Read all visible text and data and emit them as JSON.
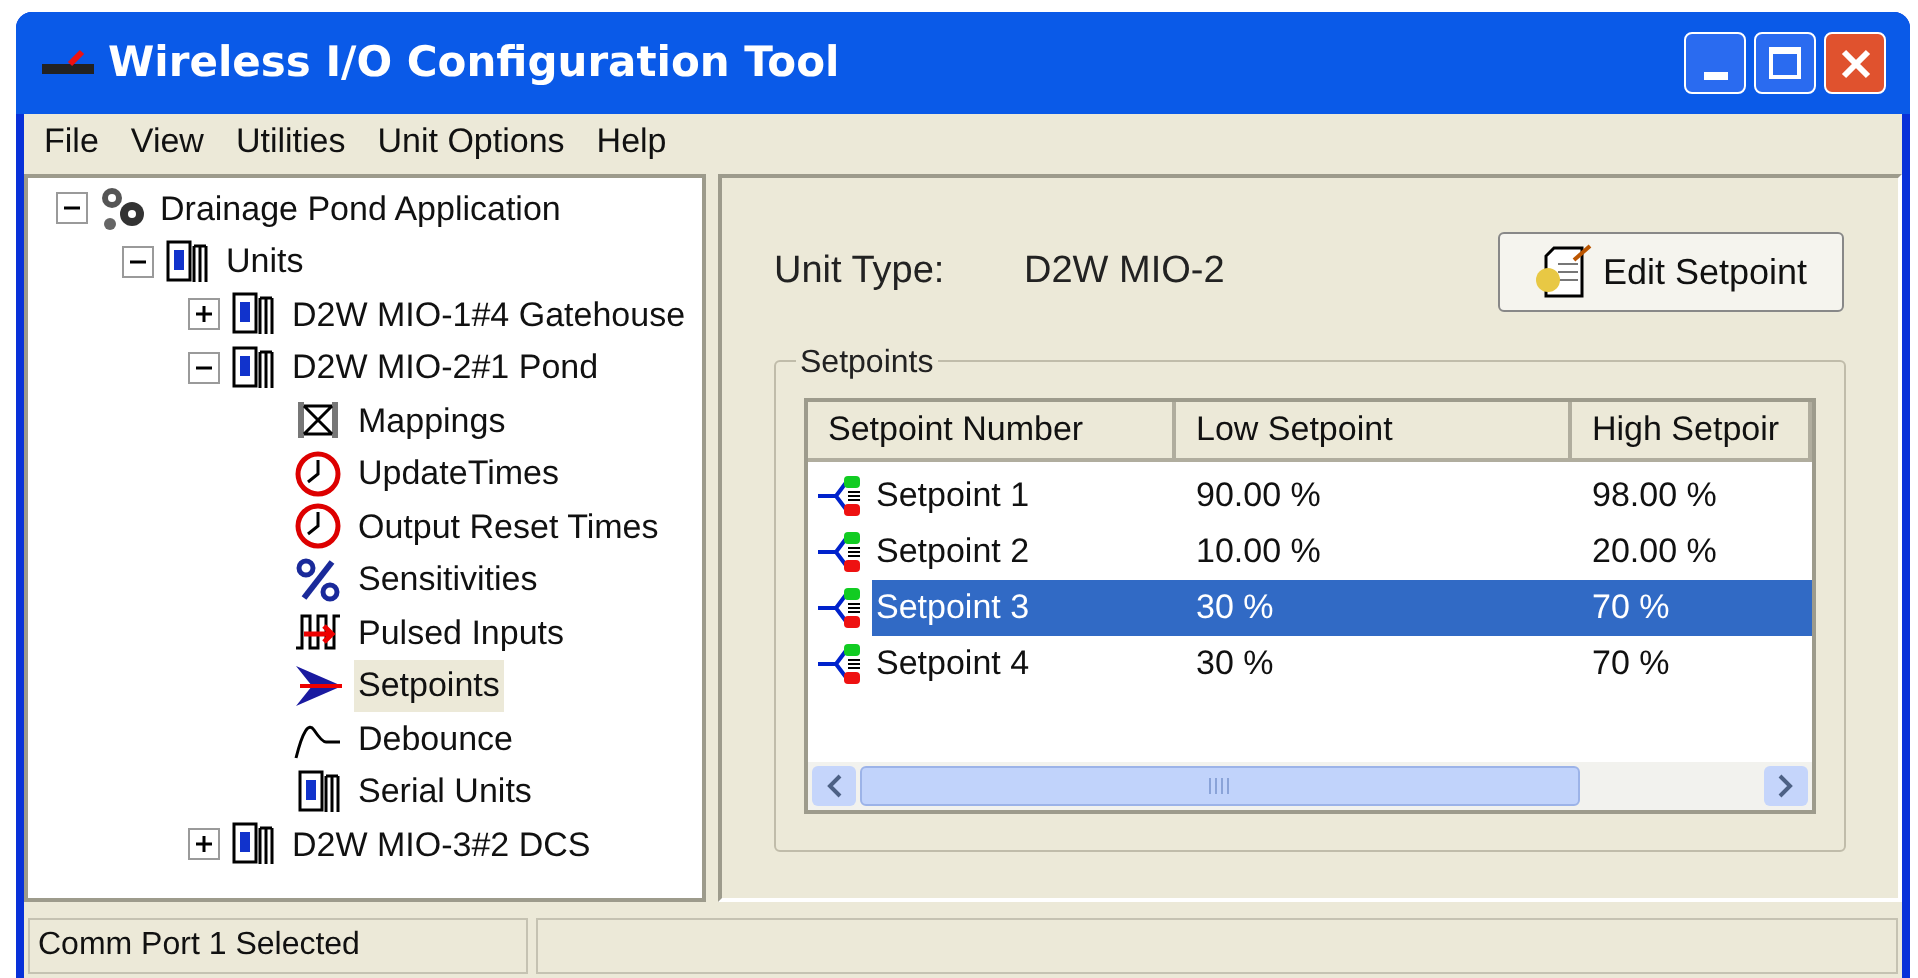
{
  "window": {
    "title": "Wireless I/O Configuration Tool"
  },
  "menu": [
    "File",
    "View",
    "Utilities",
    "Unit Options",
    "Help"
  ],
  "tree": [
    {
      "label": "Drainage Pond Application",
      "kind": "app",
      "expanded": true,
      "selected": false,
      "children": [
        {
          "label": "Units",
          "kind": "unit",
          "expanded": true,
          "selected": false,
          "children": [
            {
              "label": "D2W MIO-1#4 Gatehouse",
              "kind": "unit",
              "expanded": false,
              "selected": false
            },
            {
              "label": "D2W MIO-2#1 Pond",
              "kind": "unit",
              "expanded": true,
              "selected": false,
              "children": [
                {
                  "label": "Mappings",
                  "kind": "mapping",
                  "selected": false
                },
                {
                  "label": "UpdateTimes",
                  "kind": "clock",
                  "selected": false
                },
                {
                  "label": "Output Reset Times",
                  "kind": "clock",
                  "selected": false
                },
                {
                  "label": "Sensitivities",
                  "kind": "percent",
                  "selected": false
                },
                {
                  "label": "Pulsed Inputs",
                  "kind": "pulse",
                  "selected": false
                },
                {
                  "label": "Setpoints",
                  "kind": "arrow",
                  "selected": true
                },
                {
                  "label": "Debounce",
                  "kind": "debounce",
                  "selected": false
                },
                {
                  "label": "Serial Units",
                  "kind": "unit",
                  "selected": false
                }
              ]
            },
            {
              "label": "D2W MIO-3#2 DCS",
              "kind": "unit",
              "expanded": false,
              "selected": false
            }
          ]
        }
      ]
    }
  ],
  "unit_type": {
    "label": "Unit Type:",
    "value": "D2W MIO-2"
  },
  "edit_button": "Edit Setpoint",
  "setpoints": {
    "title": "Setpoints",
    "columns": [
      "Setpoint Number",
      "Low Setpoint",
      "High Setpoir"
    ],
    "rows": [
      {
        "cells": [
          "Setpoint 1",
          "90.00 %",
          "98.00 %"
        ],
        "selected": false
      },
      {
        "cells": [
          "Setpoint 2",
          "10.00 %",
          "20.00 %"
        ],
        "selected": false
      },
      {
        "cells": [
          "Setpoint 3",
          "30 %",
          "70 %"
        ],
        "selected": true
      },
      {
        "cells": [
          "Setpoint 4",
          "30 %",
          "70 %"
        ],
        "selected": false
      }
    ]
  },
  "status_bar": [
    "Comm Port 1 Selected"
  ]
}
